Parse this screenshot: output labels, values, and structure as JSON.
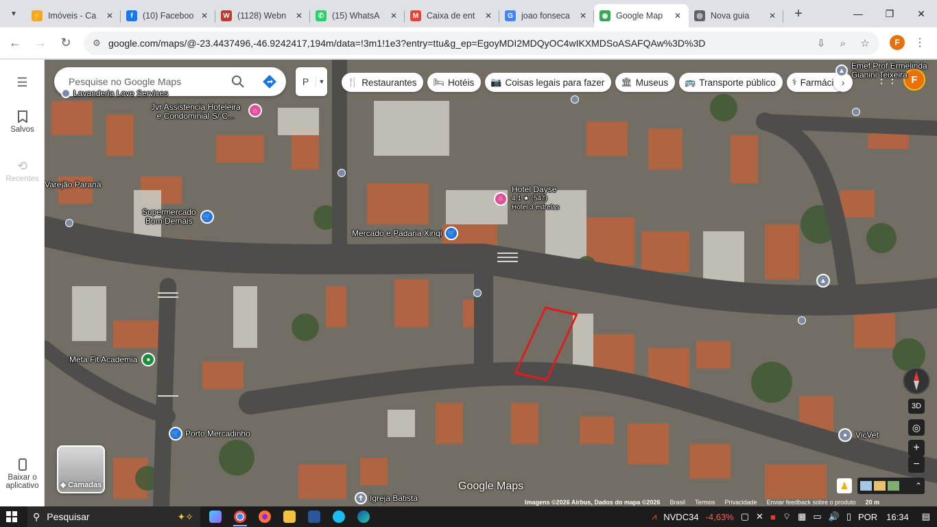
{
  "browser": {
    "tabs": [
      {
        "title": "Imóveis - Ca",
        "favicon_color": "#f5a623",
        "favicon_glyph": "⚡",
        "active": false
      },
      {
        "title": "(10) Faceboo",
        "favicon_color": "#1877f2",
        "favicon_glyph": "f",
        "active": false
      },
      {
        "title": "(1128) Webn",
        "favicon_color": "#c0392b",
        "favicon_glyph": "W",
        "active": false
      },
      {
        "title": "(15) WhatsA",
        "favicon_color": "#25d366",
        "favicon_glyph": "✆",
        "active": false
      },
      {
        "title": "Caixa de ent",
        "favicon_color": "#ea4335",
        "favicon_glyph": "M",
        "active": false
      },
      {
        "title": "joao fonseca",
        "favicon_color": "#4285f4",
        "favicon_glyph": "G",
        "active": false
      },
      {
        "title": "Google Map",
        "favicon_color": "#34a853",
        "favicon_glyph": "◉",
        "active": true
      },
      {
        "title": "Nova guia",
        "favicon_color": "#5f6368",
        "favicon_glyph": "◎",
        "active": false
      }
    ],
    "url": "google.com/maps/@-23.4437496,-46.9242417,194m/data=!3m1!1e3?entry=ttu&g_ep=EgoyMDI2MDQyOC4wIKXMDSoASAFQAw%3D%3D",
    "profile_initial": "F",
    "accent_color": "#e8710a"
  },
  "rail": {
    "menu_icon": "hamburger-icon",
    "saved_label": "Salvos",
    "recent_label": "Recentes",
    "app_label_1": "Baixar o",
    "app_label_2": "aplicativo"
  },
  "map": {
    "search_placeholder": "Pesquise no Google Maps",
    "layer_toggle": "P",
    "chips": [
      {
        "icon": "🍴",
        "label": "Restaurantes"
      },
      {
        "icon": "🛏",
        "label": "Hotéis"
      },
      {
        "icon": "📷",
        "label": "Coisas legais para fazer"
      },
      {
        "icon": "🏛",
        "label": "Museus"
      },
      {
        "icon": "🚌",
        "label": "Transporte público"
      },
      {
        "icon": "⚕",
        "label": "Farmácia"
      }
    ],
    "avatar_initial": "F",
    "pois": {
      "lavanderia": "Lavanderia Love Services",
      "assistencia_1": "Jvr Assistencia Hoteleira",
      "assistencia_2": "e Condominial S/ C...",
      "varejao": "Varejão Paraná",
      "super_1": "Supermercado",
      "super_2": "Bom Demais",
      "hotel": "Hotel Dayse",
      "hotel_rating": "4,1 ★ (547)",
      "hotel_class": "Hotel 3 estrelas",
      "mercado": "Mercado e Padaria Xinqi",
      "metafit": "Meta Fit Academia",
      "porto": "Porto Mercadinho",
      "igreja": "Igreja Batista",
      "emef_1": "Emef Prof Ermelinda",
      "emef_2": "Gianini Teixeira",
      "vicvet": "VicVet"
    },
    "layers_label": "Camadas",
    "logo_text": "Google Maps",
    "view_3d": "3D",
    "zoom_in": "+",
    "zoom_out": "−",
    "attribution": "Imagens ©2026 Airbus, Dados do mapa ©2026",
    "region": "Brasil",
    "terms": "Termos",
    "privacy": "Privacidade",
    "feedback": "Enviar feedback sobre o produto",
    "scale": "20 m"
  },
  "taskbar": {
    "search_label": "Pesquisar",
    "stock_symbol": "NVDC34",
    "stock_change": "-4,63%",
    "language": "POR",
    "time": "16:34"
  }
}
